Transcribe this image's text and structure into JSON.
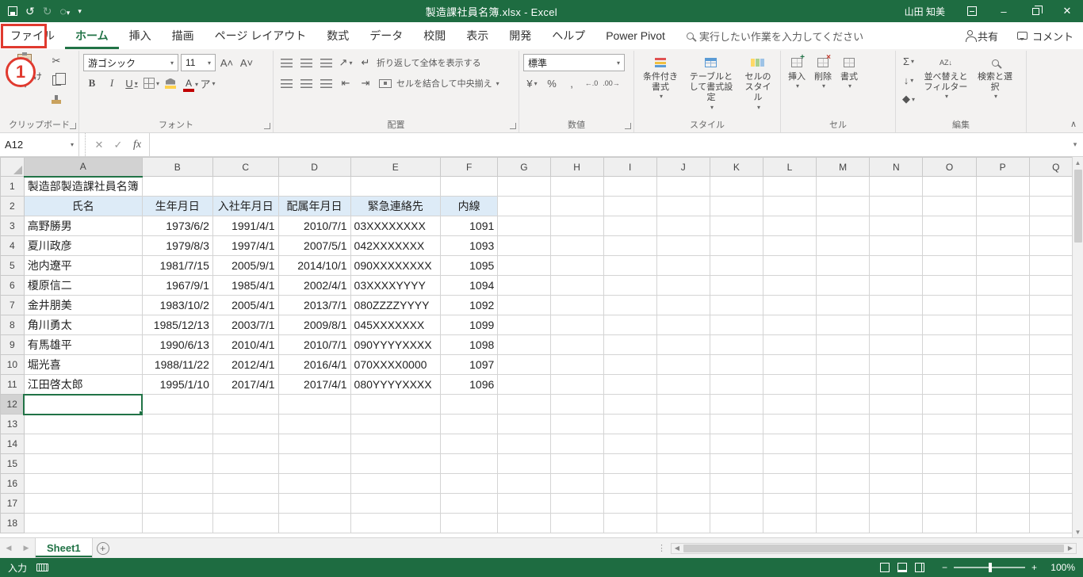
{
  "title_bar": {
    "title": "製造課社員名簿.xlsx - Excel",
    "user": "山田 知美"
  },
  "ribbon": {
    "tabs": [
      "ファイル",
      "ホーム",
      "挿入",
      "描画",
      "ページ レイアウト",
      "数式",
      "データ",
      "校閲",
      "表示",
      "開発",
      "ヘルプ",
      "Power Pivot"
    ],
    "active_tab": "ホーム",
    "search_text": "実行したい作業を入力してください",
    "share": "共有",
    "comments": "コメント",
    "clipboard": {
      "label": "クリップボード",
      "paste": "貼り付け"
    },
    "font": {
      "label": "フォント",
      "font_name": "游ゴシック",
      "font_size": "11"
    },
    "alignment": {
      "label": "配置",
      "wrap": "折り返して全体を表示する",
      "merge": "セルを結合して中央揃え"
    },
    "number": {
      "label": "数値",
      "format": "標準"
    },
    "styles": {
      "label": "スタイル",
      "conditional": "条件付き書式",
      "format_table": "テーブルとして書式設定",
      "cell_styles": "セルのスタイル"
    },
    "cells": {
      "label": "セル",
      "insert": "挿入",
      "delete": "削除",
      "format": "書式"
    },
    "editing": {
      "label": "編集",
      "sort": "並べ替えとフィルター",
      "find": "検索と選択"
    }
  },
  "formula_bar": {
    "name_box": "A12",
    "fx": "fx"
  },
  "sheet": {
    "columns": [
      "A",
      "B",
      "C",
      "D",
      "E",
      "F",
      "G",
      "H",
      "I",
      "J",
      "K",
      "L",
      "M",
      "N",
      "O",
      "P",
      "Q"
    ],
    "visible_rows": 18,
    "active_col": "A",
    "active_row": 12,
    "active_cell": "A12",
    "title_cell": "製造部製造課社員名簿",
    "header_row": [
      "氏名",
      "生年月日",
      "入社年月日",
      "配属年月日",
      "緊急連絡先",
      "内線"
    ],
    "data_rows": [
      [
        "高野勝男",
        "1973/6/2",
        "1991/4/1",
        "2010/7/1",
        "03XXXXXXXX",
        "1091"
      ],
      [
        "夏川政彦",
        "1979/8/3",
        "1997/4/1",
        "2007/5/1",
        "042XXXXXXX",
        "1093"
      ],
      [
        "池内遼平",
        "1981/7/15",
        "2005/9/1",
        "2014/10/1",
        "090XXXXXXXX",
        "1095"
      ],
      [
        "榎原信二",
        "1967/9/1",
        "1985/4/1",
        "2002/4/1",
        "03XXXXYYYY",
        "1094"
      ],
      [
        "金井朋美",
        "1983/10/2",
        "2005/4/1",
        "2013/7/1",
        "080ZZZZYYYY",
        "1092"
      ],
      [
        "角川勇太",
        "1985/12/13",
        "2003/7/1",
        "2009/8/1",
        "045XXXXXXX",
        "1099"
      ],
      [
        "有馬雄平",
        "1990/6/13",
        "2010/4/1",
        "2010/7/1",
        "090YYYYXXXX",
        "1098"
      ],
      [
        "堀光喜",
        "1988/11/22",
        "2012/4/1",
        "2016/4/1",
        "070XXXX0000",
        "1097"
      ],
      [
        "江田啓太郎",
        "1995/1/10",
        "2017/4/1",
        "2017/4/1",
        "080YYYYXXXX",
        "1096"
      ]
    ]
  },
  "sheet_tabs": {
    "active": "Sheet1"
  },
  "status_bar": {
    "mode": "入力",
    "zoom": "100%"
  },
  "annotation": {
    "step": "1"
  }
}
